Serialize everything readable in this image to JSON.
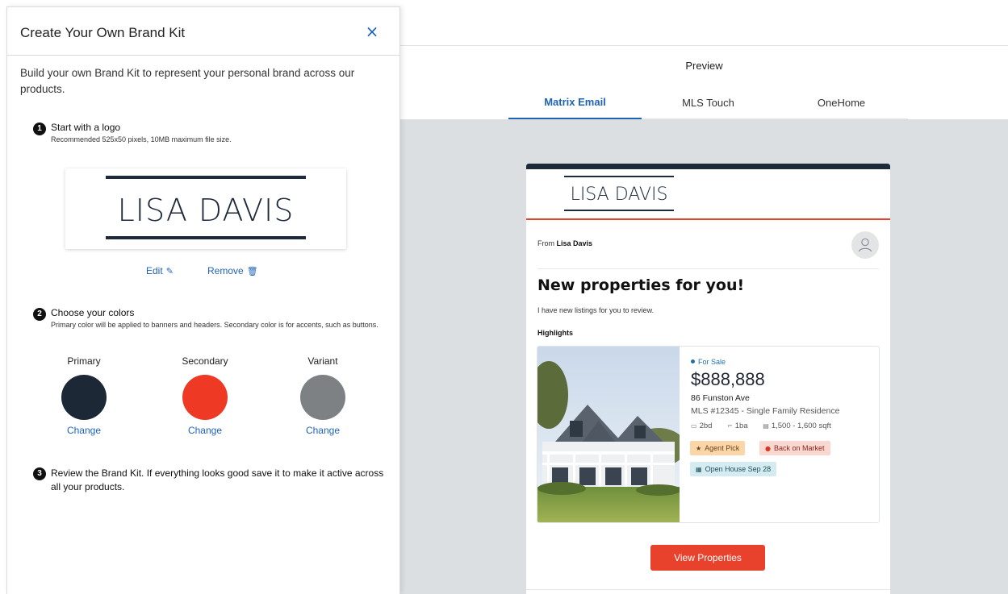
{
  "panel": {
    "title": "Create Your Own Brand Kit",
    "close_label": "×",
    "intro": "Build your own Brand Kit to represent your personal brand across our products."
  },
  "steps": {
    "logo": {
      "number": "1",
      "title": "Start with a logo",
      "desc": "Recommended 525x50 pixels, 10MB maximum file size.",
      "logo_text": "LISA DAVIS",
      "edit_label": "Edit",
      "remove_label": "Remove"
    },
    "colors": {
      "number": "2",
      "title": "Choose your colors",
      "desc": "Primary color will be applied to banners and headers. Secondary color is for accents, such as buttons.",
      "change_label": "Change",
      "swatches": [
        {
          "label": "Primary",
          "color": "#1d2837"
        },
        {
          "label": "Secondary",
          "color": "#ee3a24"
        },
        {
          "label": "Variant",
          "color": "#7d8184"
        }
      ]
    },
    "review": {
      "number": "3",
      "text": "Review the Brand Kit. If everything looks good save it to make it active across all your products."
    }
  },
  "preview": {
    "title": "Preview",
    "tabs": [
      {
        "label": "Matrix Email",
        "active": true
      },
      {
        "label": "MLS Touch",
        "active": false
      },
      {
        "label": "OneHome",
        "active": false
      }
    ]
  },
  "email": {
    "logo_text": "LISA DAVIS",
    "from_prefix": "From",
    "from_name": "Lisa Davis",
    "headline": "New properties for you!",
    "subtext": "I have new listings for you to review.",
    "highlights_label": "Highlights",
    "listing": {
      "status": "For Sale",
      "price": "$888,888",
      "address": "86 Funston Ave",
      "mls": "MLS #12345 - Single Family Residence",
      "beds": "2bd",
      "baths": "1ba",
      "sqft": "1,500 - 1,600 sqft",
      "chips": {
        "agent_pick": "Agent Pick",
        "back_on_market": "Back on Market",
        "open_house": "Open House Sep 28"
      }
    },
    "cta_label": "View Properties"
  },
  "colors": {
    "accent_blue": "#1f63b5",
    "brand_primary": "#1d2a3a",
    "brand_secondary": "#e8412c",
    "preview_bg": "#dcdfe1"
  }
}
